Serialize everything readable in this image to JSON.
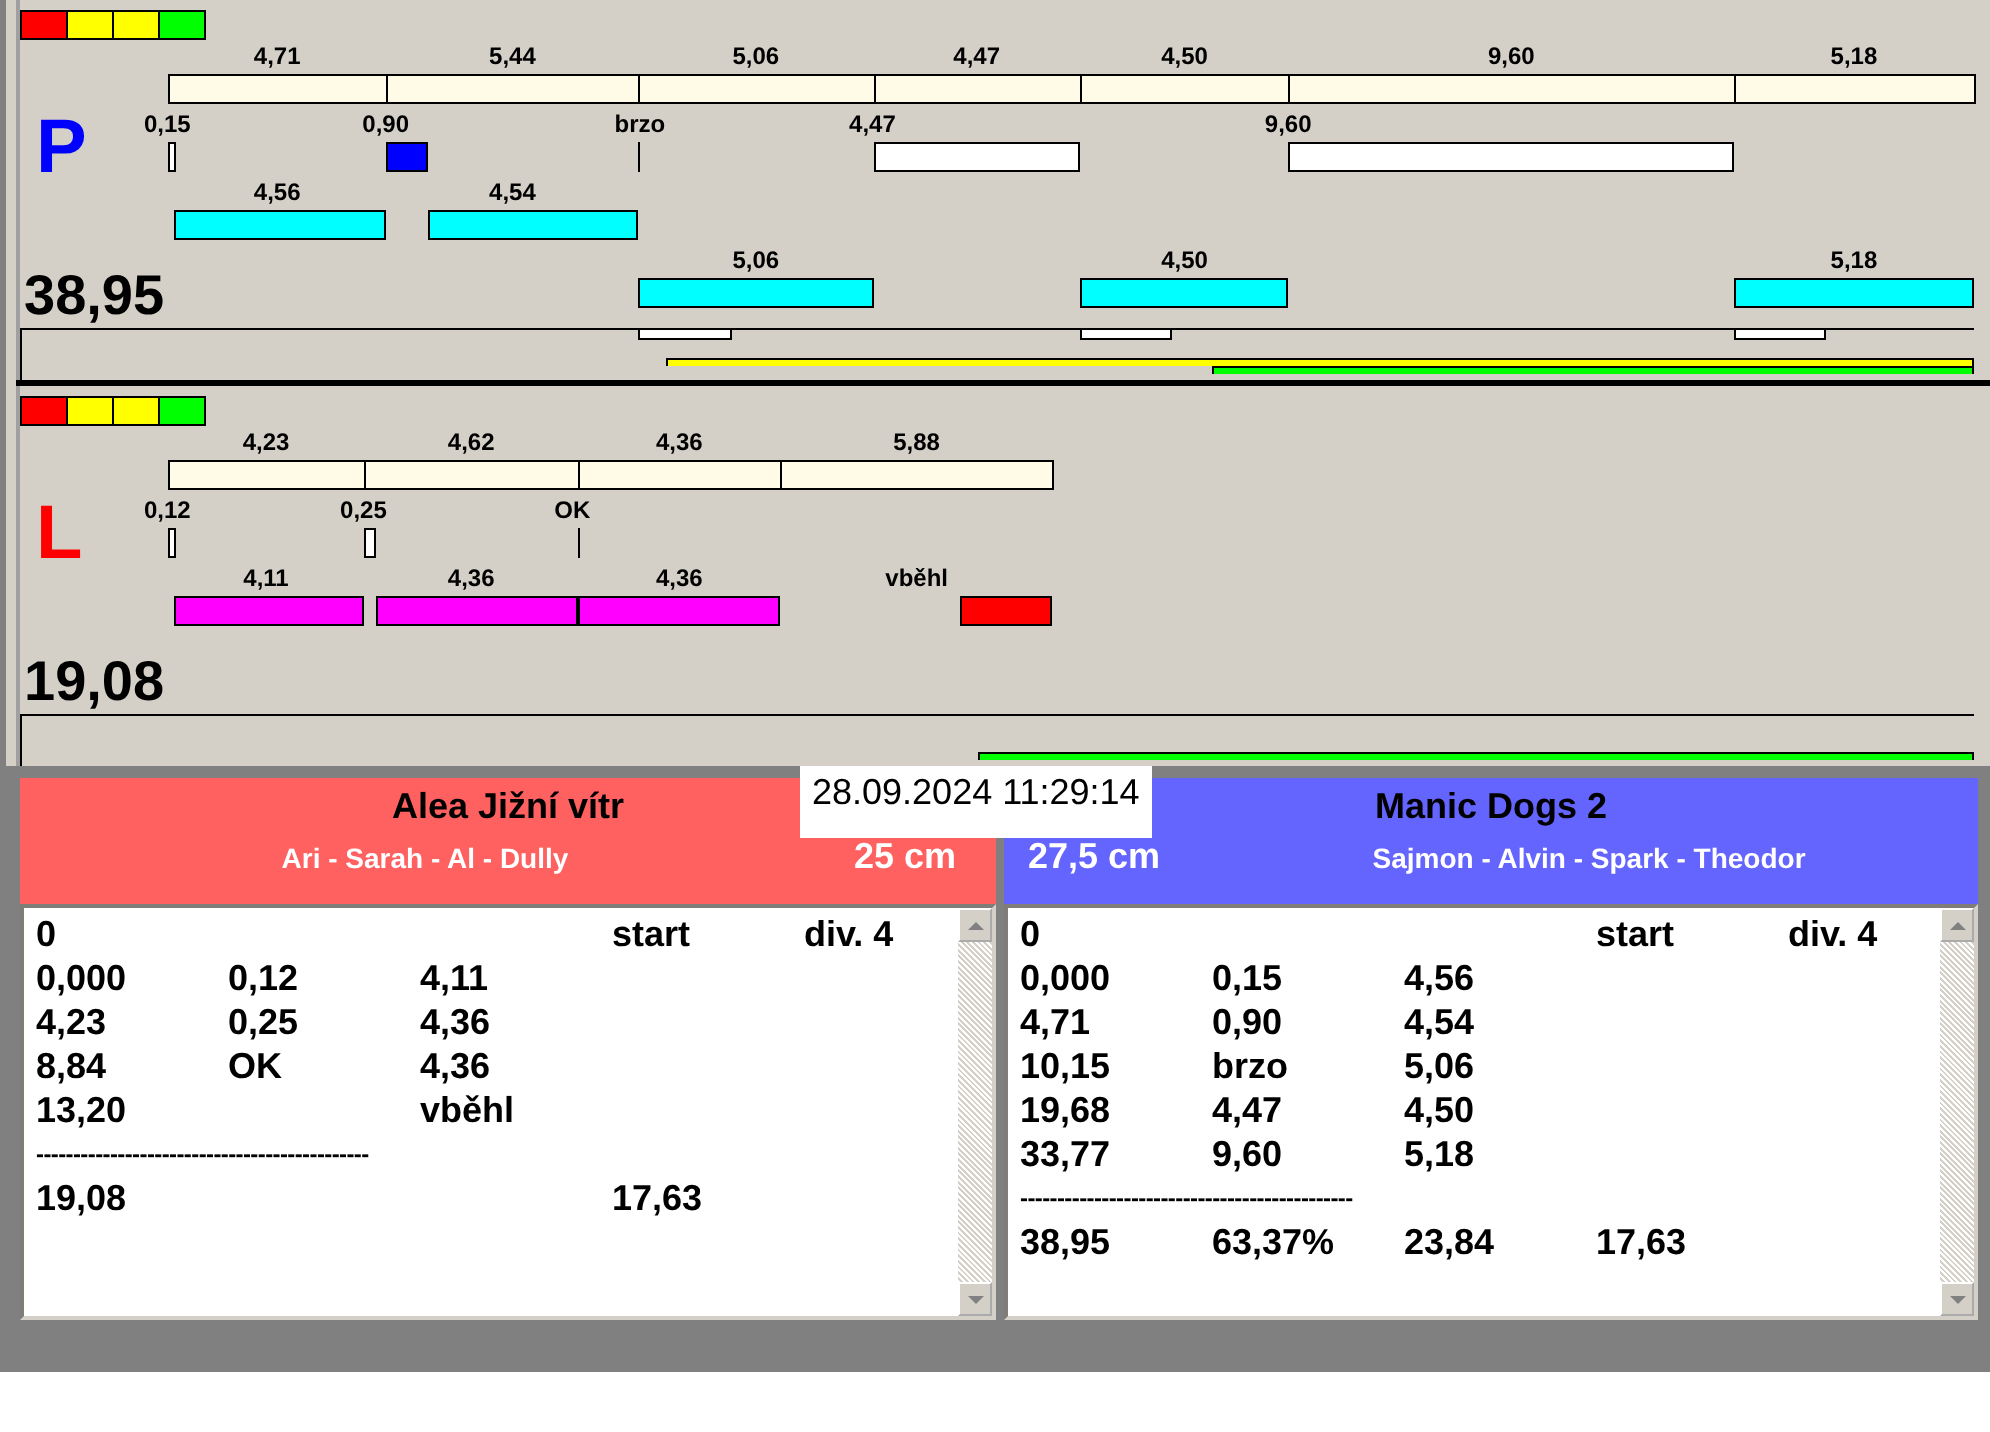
{
  "lanes": [
    {
      "letter": "P",
      "color": "#0000ff",
      "total": "38,95",
      "lights": [
        {
          "color": "#ff0000"
        },
        {
          "color": "#ffff00"
        },
        {
          "color": "#ffff00"
        },
        {
          "color": "#00ff00"
        }
      ],
      "segments": [
        {
          "time": "4,71",
          "mark": {
            "kind": "bar",
            "label": "0,15",
            "color": "#ffffff"
          },
          "run": {
            "label": "4,56",
            "color": "#00ffff"
          },
          "flag": false
        },
        {
          "time": "5,44",
          "mark": {
            "kind": "bar",
            "label": "0,90",
            "color": "#0000ff"
          },
          "run": {
            "label": "4,54",
            "color": "#00ffff"
          },
          "flag": false
        },
        {
          "time": "5,06",
          "mark": {
            "kind": "tick",
            "label": "brzo"
          },
          "run_lower": {
            "label": "5,06",
            "color": "#00ffff"
          },
          "flag": true
        },
        {
          "time": "4,47",
          "mark": {
            "kind": "bar",
            "label": "4,47",
            "color": "#ffffff"
          },
          "flag": false
        },
        {
          "time": "4,50",
          "run_lower": {
            "label": "4,50",
            "color": "#00ffff"
          },
          "flag": true
        },
        {
          "time": "9,60",
          "mark": {
            "kind": "bar",
            "label": "9,60",
            "color": "#ffffff"
          },
          "flag": false
        },
        {
          "time": "5,18",
          "run_lower": {
            "label": "5,18",
            "color": "#00ffff"
          },
          "flag": true
        }
      ],
      "progress": [
        {
          "color": "#ffff00",
          "level": 0.67
        },
        {
          "color": "#00ff00",
          "level": 0.39
        }
      ]
    },
    {
      "letter": "L",
      "color": "#ff0000",
      "total": "19,08",
      "lights": [
        {
          "color": "#ff0000"
        },
        {
          "color": "#ffff00"
        },
        {
          "color": "#ffff00"
        },
        {
          "color": "#00ff00"
        }
      ],
      "segments": [
        {
          "time": "4,23",
          "mark": {
            "kind": "bar",
            "label": "0,12",
            "color": "#ffffff"
          },
          "run": {
            "label": "4,11",
            "color": "#ff00ff"
          },
          "flag": false
        },
        {
          "time": "4,62",
          "mark": {
            "kind": "bar",
            "label": "0,25",
            "color": "#ffffff"
          },
          "run": {
            "label": "4,36",
            "color": "#ff00ff"
          },
          "flag": false
        },
        {
          "time": "4,36",
          "mark": {
            "kind": "tick",
            "label": "OK"
          },
          "run": {
            "label": "4,36",
            "color": "#ff00ff"
          },
          "flag": false
        },
        {
          "time": "5,88",
          "run": {
            "label": "vběhl",
            "color": "#ff0000"
          },
          "flag": false
        }
      ],
      "progress": [
        {
          "color": "#00ff00",
          "level": 0.51
        }
      ]
    }
  ],
  "timestamp": "28.09.2024 11:29:14",
  "teams": [
    {
      "name": "Alea Jižní vítr",
      "handlers": "Ari - Sarah - Al - Dully",
      "height": "25 cm",
      "color": "#ff6060",
      "rows": [
        {
          "kind": "row",
          "cells": [
            "0",
            null,
            null,
            "start",
            "div. 4"
          ]
        },
        {
          "kind": "row",
          "cells": [
            "0,000",
            "0,12",
            "4,11",
            null,
            null
          ]
        },
        {
          "kind": "row",
          "cells": [
            "4,23",
            "0,25",
            "4,36",
            null,
            null
          ]
        },
        {
          "kind": "row",
          "cells": [
            "8,84",
            "OK",
            "4,36",
            null,
            null
          ]
        },
        {
          "kind": "row",
          "cells": [
            "13,20",
            null,
            "vběhl",
            null,
            null
          ]
        },
        {
          "kind": "rule",
          "text": "---------------------------------------------"
        },
        {
          "kind": "row",
          "cells": [
            "19,08",
            null,
            null,
            "17,63",
            null
          ]
        }
      ]
    },
    {
      "name": "Manic Dogs 2",
      "handlers": "Sajmon - Alvin - Spark - Theodor",
      "height": "27,5 cm",
      "color": "#6464ff",
      "rows": [
        {
          "kind": "row",
          "cells": [
            "0",
            null,
            null,
            "start",
            "div. 4"
          ]
        },
        {
          "kind": "row",
          "cells": [
            "0,000",
            "0,15",
            "4,56",
            null,
            null
          ]
        },
        {
          "kind": "row",
          "cells": [
            "4,71",
            "0,90",
            "4,54",
            null,
            null
          ]
        },
        {
          "kind": "row",
          "cells": [
            "10,15",
            "brzo",
            "5,06",
            null,
            null
          ]
        },
        {
          "kind": "row",
          "cells": [
            "19,68",
            "4,47",
            "4,50",
            null,
            null
          ]
        },
        {
          "kind": "row",
          "cells": [
            "33,77",
            "9,60",
            "5,18",
            null,
            null
          ]
        },
        {
          "kind": "rule",
          "text": "---------------------------------------------"
        },
        {
          "kind": "row",
          "cells": [
            "38,95",
            "63,37%",
            "23,84",
            "17,63",
            null
          ]
        }
      ]
    }
  ]
}
